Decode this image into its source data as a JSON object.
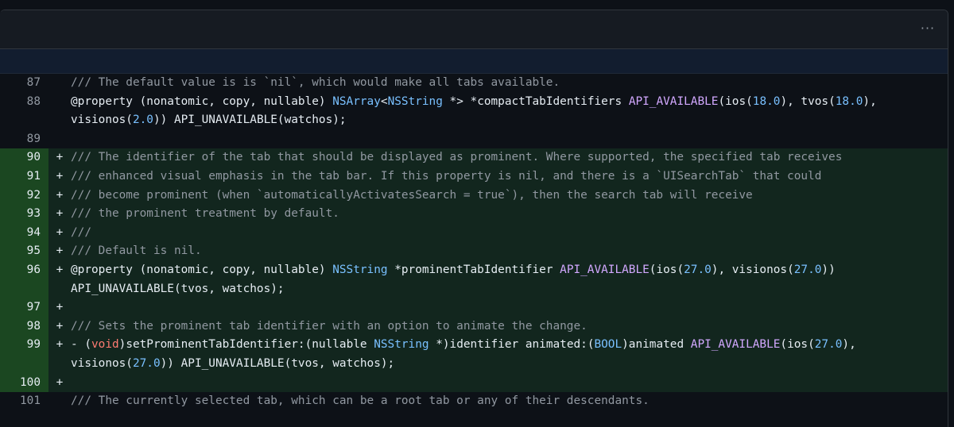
{
  "toolbar": {
    "more_label": "···"
  },
  "lines": [
    {
      "n": "87",
      "type": "ctx",
      "marker": "",
      "tokens": [
        {
          "c": "cmt",
          "t": "/// The default value is is `nil`, which would make all tabs available."
        }
      ]
    },
    {
      "n": "88",
      "type": "ctx",
      "marker": "",
      "tokens": [
        {
          "c": "",
          "t": "@property (nonatomic, copy, nullable) "
        },
        {
          "c": "ty",
          "t": "NSArray"
        },
        {
          "c": "",
          "t": "<"
        },
        {
          "c": "ty",
          "t": "NSString"
        },
        {
          "c": "",
          "t": " *> *compactTabIdentifiers "
        },
        {
          "c": "mac",
          "t": "API_AVAILABLE"
        },
        {
          "c": "",
          "t": "(ios("
        },
        {
          "c": "num-lit",
          "t": "18.0"
        },
        {
          "c": "",
          "t": "), tvos("
        },
        {
          "c": "num-lit",
          "t": "18.0"
        },
        {
          "c": "",
          "t": "),\nvisionos("
        },
        {
          "c": "num-lit",
          "t": "2.0"
        },
        {
          "c": "",
          "t": ")) API_UNAVAILABLE(watchos);"
        }
      ]
    },
    {
      "n": "89",
      "type": "ctx",
      "marker": "",
      "tokens": [
        {
          "c": "",
          "t": ""
        }
      ]
    },
    {
      "n": "90",
      "type": "add",
      "marker": "+",
      "tokens": [
        {
          "c": "cmt",
          "t": "/// The identifier of the tab that should be displayed as prominent. Where supported, the specified tab receives"
        }
      ]
    },
    {
      "n": "91",
      "type": "add",
      "marker": "+",
      "tokens": [
        {
          "c": "cmt",
          "t": "/// enhanced visual emphasis in the tab bar. If this property is nil, and there is a `UISearchTab` that could"
        }
      ]
    },
    {
      "n": "92",
      "type": "add",
      "marker": "+",
      "tokens": [
        {
          "c": "cmt",
          "t": "/// become prominent (when `automaticallyActivatesSearch = true`), then the search tab will receive"
        }
      ]
    },
    {
      "n": "93",
      "type": "add",
      "marker": "+",
      "tokens": [
        {
          "c": "cmt",
          "t": "/// the prominent treatment by default."
        }
      ]
    },
    {
      "n": "94",
      "type": "add",
      "marker": "+",
      "tokens": [
        {
          "c": "cmt",
          "t": "///"
        }
      ]
    },
    {
      "n": "95",
      "type": "add",
      "marker": "+",
      "tokens": [
        {
          "c": "cmt",
          "t": "/// Default is nil."
        }
      ]
    },
    {
      "n": "96",
      "type": "add",
      "marker": "+",
      "tokens": [
        {
          "c": "",
          "t": "@property (nonatomic, copy, nullable) "
        },
        {
          "c": "ty",
          "t": "NSString"
        },
        {
          "c": "",
          "t": " *prominentTabIdentifier "
        },
        {
          "c": "mac",
          "t": "API_AVAILABLE"
        },
        {
          "c": "",
          "t": "(ios("
        },
        {
          "c": "num-lit",
          "t": "27.0"
        },
        {
          "c": "",
          "t": "), visionos("
        },
        {
          "c": "num-lit",
          "t": "27.0"
        },
        {
          "c": "",
          "t": "))\nAPI_UNAVAILABLE(tvos, watchos);"
        }
      ]
    },
    {
      "n": "97",
      "type": "add",
      "marker": "+",
      "tokens": [
        {
          "c": "",
          "t": ""
        }
      ]
    },
    {
      "n": "98",
      "type": "add",
      "marker": "+",
      "tokens": [
        {
          "c": "cmt",
          "t": "/// Sets the prominent tab identifier with an option to animate the change."
        }
      ]
    },
    {
      "n": "99",
      "type": "add",
      "marker": "+",
      "tokens": [
        {
          "c": "",
          "t": "- ("
        },
        {
          "c": "kw",
          "t": "void"
        },
        {
          "c": "",
          "t": ")setProminentTabIdentifier:(nullable "
        },
        {
          "c": "ty",
          "t": "NSString"
        },
        {
          "c": "",
          "t": " *)identifier animated:("
        },
        {
          "c": "ty",
          "t": "BOOL"
        },
        {
          "c": "",
          "t": ")animated "
        },
        {
          "c": "mac",
          "t": "API_AVAILABLE"
        },
        {
          "c": "",
          "t": "(ios("
        },
        {
          "c": "num-lit",
          "t": "27.0"
        },
        {
          "c": "",
          "t": "),\nvisionos("
        },
        {
          "c": "num-lit",
          "t": "27.0"
        },
        {
          "c": "",
          "t": ")) API_UNAVAILABLE(tvos, watchos);"
        }
      ]
    },
    {
      "n": "100",
      "type": "add",
      "marker": "+",
      "tokens": [
        {
          "c": "",
          "t": ""
        }
      ]
    },
    {
      "n": "101",
      "type": "ctx",
      "marker": "",
      "tokens": [
        {
          "c": "cmt",
          "t": "/// The currently selected tab, which can be a root tab or any of their descendants."
        }
      ]
    }
  ]
}
